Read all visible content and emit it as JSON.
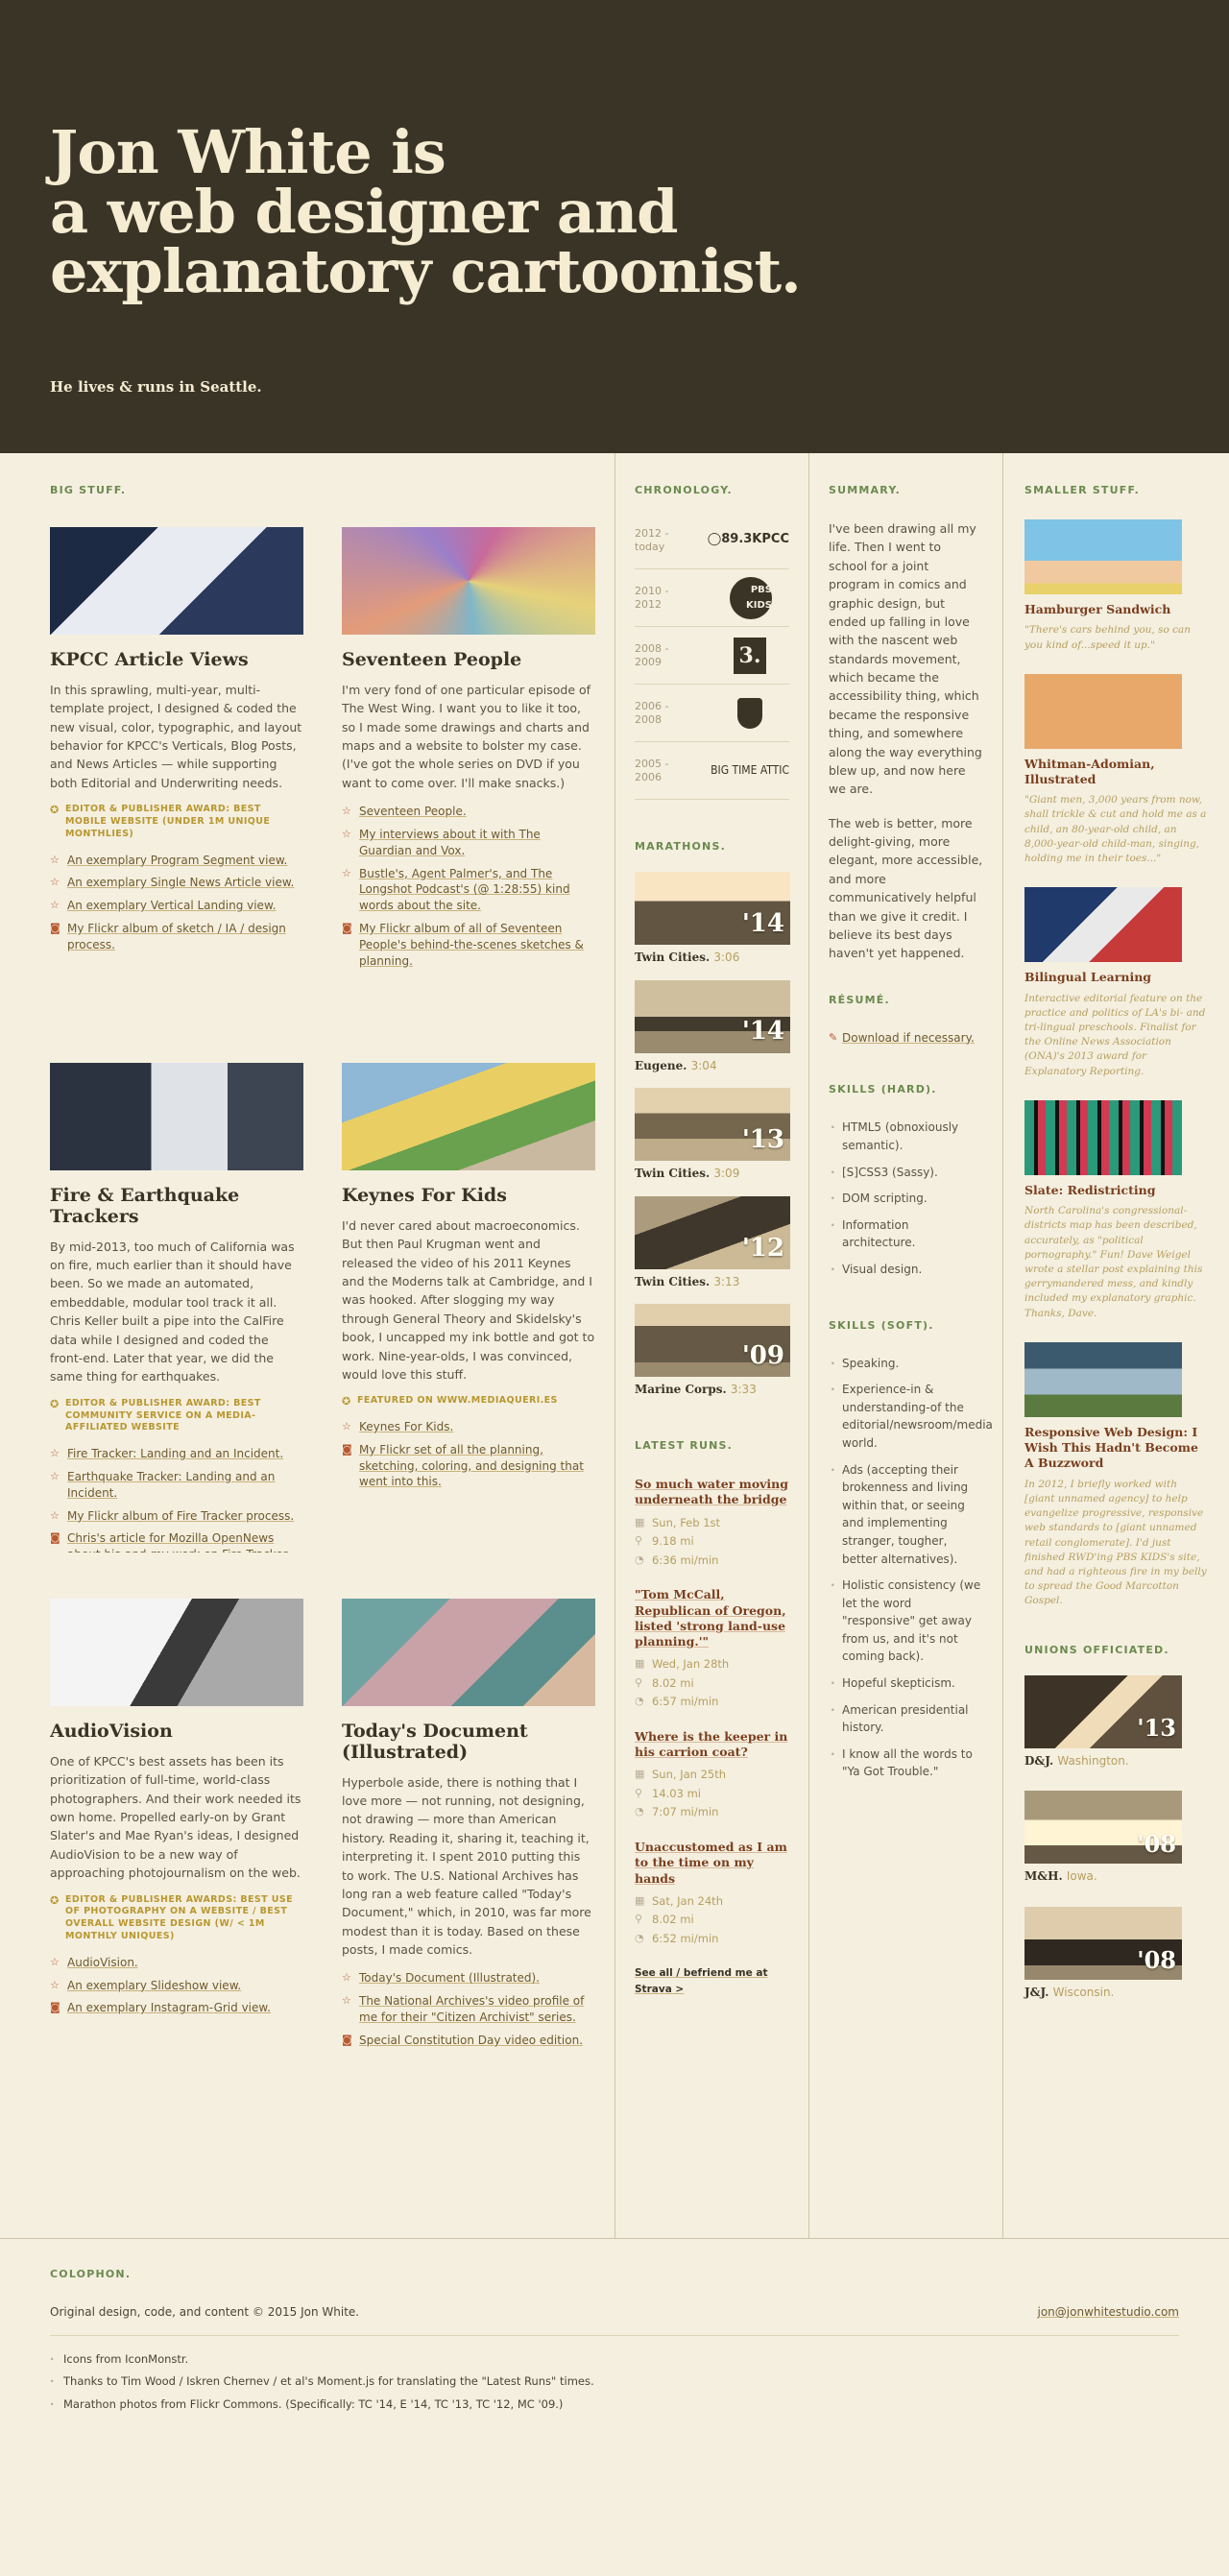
{
  "hero": {
    "title_line1": "Jon White is",
    "title_line2": "a web designer and",
    "title_line3": "explanatory cartoonist.",
    "subtitle": "He lives & runs in Seattle."
  },
  "big_stuff": {
    "label": "Big stuff.",
    "projects": [
      {
        "title": "KPCC Article Views",
        "desc": "In this sprawling, multi-year, multi-template project, I designed & coded the new visual, color, typographic, and layout behavior for KPCC's Verticals, Blog Posts, and News Articles — while supporting both Editorial and Underwriting needs.",
        "award": "Editor & Publisher Award: Best Mobile Website (under 1M unique monthlies)",
        "links": [
          "An exemplary Program Segment view.",
          "An exemplary Single News Article view.",
          "An exemplary Vertical Landing view.",
          "My Flickr album of sketch / IA / design process."
        ]
      },
      {
        "title": "Seventeen People",
        "desc": "I'm very fond of one particular episode of The West Wing. I want you to like it too, so I made some drawings and charts and maps and a website to bolster my case. (I've got the whole series on DVD if you want to come over. I'll make snacks.)",
        "award": "",
        "links": [
          "Seventeen People.",
          "My interviews about it with The Guardian and Vox.",
          "Bustle's, Agent Palmer's, and The Longshot Podcast's (@ 1:28:55) kind words about the site.",
          "My Flickr album of all of Seventeen People's behind-the-scenes sketches & planning."
        ]
      },
      {
        "title": "Fire & Earthquake Trackers",
        "desc": "By mid-2013, too much of California was on fire, much earlier than it should have been. So we made an automated, embeddable, modular tool track it all. Chris Keller built a pipe into the CalFire data while I designed and coded the front-end. Later that year, we did the same thing for earthquakes.",
        "award": "Editor & Publisher Award: Best Community Service on a Media-Affiliated Website",
        "links": [
          "Fire Tracker: Landing and an Incident.",
          "Earthquake Tracker: Landing and an Incident.",
          "My Flickr album of Fire Tracker process.",
          "Chris's article for Mozilla OpenNews about his-and-my work on Fire Tracker."
        ]
      },
      {
        "title": "Keynes For Kids",
        "desc": "I'd never cared about macroeconomics. But then Paul Krugman went and released the video of his 2011 Keynes and the Moderns talk at Cambridge, and I was hooked. After slogging my way through General Theory and Skidelsky's book, I uncapped my ink bottle and got to work. Nine-year-olds, I was convinced, would love this stuff.",
        "award": "Featured on www.mediaqueri.es",
        "links": [
          "Keynes For Kids.",
          "My Flickr set of all the planning, sketching, coloring, and designing that went into this."
        ]
      },
      {
        "title": "AudioVision",
        "desc": "One of KPCC's best assets has been its prioritization of full-time, world-class photographers. And their work needed its own home. Propelled early-on by Grant Slater's and Mae Ryan's ideas, I designed AudioVision to be a new way of approaching photojournalism on the web.",
        "award": "Editor & Publisher Awards: Best Use of Photography on a Website / Best Overall Website Design (w/ < 1M monthly uniques)",
        "links": [
          "AudioVision.",
          "An exemplary Slideshow view.",
          "An exemplary Instagram-Grid view."
        ]
      },
      {
        "title": "Today's Document (Illustrated)",
        "desc": "Hyperbole aside, there is nothing that I love more — not running, not designing, not drawing — more than American history. Reading it, sharing it, teaching it, interpreting it. I spent 2010 putting this to work. The U.S. National Archives has long ran a web feature called \"Today's Document,\" which, in 2010, was far more modest than it is today. Based on these posts, I made comics.",
        "award": "",
        "links": [
          "Today's Document (Illustrated).",
          "The National Archives's video profile of me for their \"Citizen Archivist\" series.",
          "Special Constitution Day video edition."
        ]
      }
    ]
  },
  "chronology": {
    "label": "Chronology.",
    "items": [
      {
        "years": "2012 - today",
        "logo": "◯89.3KPCC"
      },
      {
        "years": "2010 - 2012",
        "logo": "PBS KIDS"
      },
      {
        "years": "2008 - 2009",
        "logo": "3."
      },
      {
        "years": "2006 - 2008",
        "logo": ""
      },
      {
        "years": "2005 - 2006",
        "logo": "BIG TIME ATTIC"
      }
    ]
  },
  "marathons": {
    "label": "Marathons.",
    "items": [
      {
        "place": "Twin Cities.",
        "time": "3:06",
        "year": "'14"
      },
      {
        "place": "Eugene.",
        "time": "3:04",
        "year": "'14"
      },
      {
        "place": "Twin Cities.",
        "time": "3:09",
        "year": "'13"
      },
      {
        "place": "Twin Cities.",
        "time": "3:13",
        "year": "'12"
      },
      {
        "place": "Marine Corps.",
        "time": "3:33",
        "year": "'09"
      }
    ]
  },
  "runs": {
    "label": "Latest runs.",
    "items": [
      {
        "title": "So much water moving underneath the bridge",
        "date": "Sun, Feb 1st",
        "dist": "9.18 mi",
        "pace": "6:36 mi/min"
      },
      {
        "title": "\"Tom McCall, Republican of Oregon, listed 'strong land-use planning.'\"",
        "date": "Wed, Jan 28th",
        "dist": "8.02 mi",
        "pace": "6:57 mi/min"
      },
      {
        "title": "Where is the keeper in his carrion coat?",
        "date": "Sun, Jan 25th",
        "dist": "14.03 mi",
        "pace": "7:07 mi/min"
      },
      {
        "title": "Unaccustomed as I am to the time on my hands",
        "date": "Sat, Jan 24th",
        "dist": "8.02 mi",
        "pace": "6:52 mi/min"
      }
    ],
    "strava": "See all / befriend me at Strava >"
  },
  "summary": {
    "label": "Summary.",
    "p1": "I've been drawing all my life. Then I went to school for a joint program in comics and graphic design, but ended up falling in love with the nascent web standards movement, which became the accessibility thing, which became the responsive thing, and somewhere along the way everything blew up, and now here we are.",
    "p2": "The web is better, more delight-giving, more elegant, more accessible, and more communicatively helpful than we give it credit. I believe its best days haven't yet happened."
  },
  "resume": {
    "label": "Résumé.",
    "link": "Download if necessary."
  },
  "skills_hard": {
    "label": "Skills (hard).",
    "items": [
      "HTML5 (obnoxiously semantic).",
      "[S]CSS3 (Sassy).",
      "DOM scripting.",
      "Information architecture.",
      "Visual design."
    ]
  },
  "skills_soft": {
    "label": "Skills (soft).",
    "items": [
      "Speaking.",
      "Experience-in & understanding-of the editorial/newsroom/media world.",
      "Ads (accepting their brokenness and living within that, or seeing and implementing stranger, tougher, better alternatives).",
      "Holistic consistency (we let the word \"responsive\" get away from us, and it's not coming back).",
      "Hopeful skepticism.",
      "American presidential history.",
      "I know all the words to \"Ya Got Trouble.\""
    ]
  },
  "smaller": {
    "label": "Smaller stuff.",
    "items": [
      {
        "title": "Hamburger Sandwich",
        "desc": "\"There's cars behind you, so can you kind of...speed it up.\""
      },
      {
        "title": "Whitman-Adomian, Illustrated",
        "desc": "\"Giant men, 3,000 years from now, shall trickle & cut and hold me as a child, an 80-year-old child, an 8,000-year-old child-man, singing, holding me in their toes...\""
      },
      {
        "title": "Bilingual Learning",
        "desc": "Interactive editorial feature on the practice and politics of LA's bi- and tri-lingual preschools. Finalist for the Online News Association (ONA)'s 2013 award for Explanatory Reporting."
      },
      {
        "title": "Slate: Redistricting",
        "desc": "North Carolina's congressional-districts map has been described, accurately, as \"political pornography.\" Fun! Dave Weigel wrote a stellar post explaining this gerrymandered mess, and kindly included my explanatory graphic. Thanks, Dave."
      },
      {
        "title": "Responsive Web Design: I Wish This Hadn't Become A Buzzword",
        "desc": "In 2012, I briefly worked with [giant unnamed agency] to help evangelize progressive, responsive web standards to [giant unnamed retail conglomerate]. I'd just finished RWD'ing PBS KIDS's site, and had a righteous fire in my belly to spread the Good Marcotton Gospel."
      }
    ]
  },
  "unions": {
    "label": "Unions officiated.",
    "items": [
      {
        "names": "D&J.",
        "place": "Washington.",
        "year": "'13"
      },
      {
        "names": "M&H.",
        "place": "Iowa.",
        "year": "'08"
      },
      {
        "names": "J&J.",
        "place": "Wisconsin.",
        "year": "'08"
      }
    ]
  },
  "colophon": {
    "label": "Colophon.",
    "copyright": "Original design, code, and content © 2015 Jon White.",
    "email": "jon@jonwhitestudio.com",
    "credits": [
      "Icons from IconMonstr.",
      "Thanks to Tim Wood / Iskren Chernev / et al's Moment.js for translating the \"Latest Runs\" times.",
      "Marathon photos from Flickr Commons. (Specifically: TC '14, E '14, TC '13, TC '12, MC '09.)"
    ]
  },
  "colors": {
    "hero_bg": "#3a3427",
    "page_bg": "#f5efe0",
    "label_green": "#6b8a4e",
    "award_gold": "#b8972f",
    "link_brown": "#7a3f1e"
  }
}
